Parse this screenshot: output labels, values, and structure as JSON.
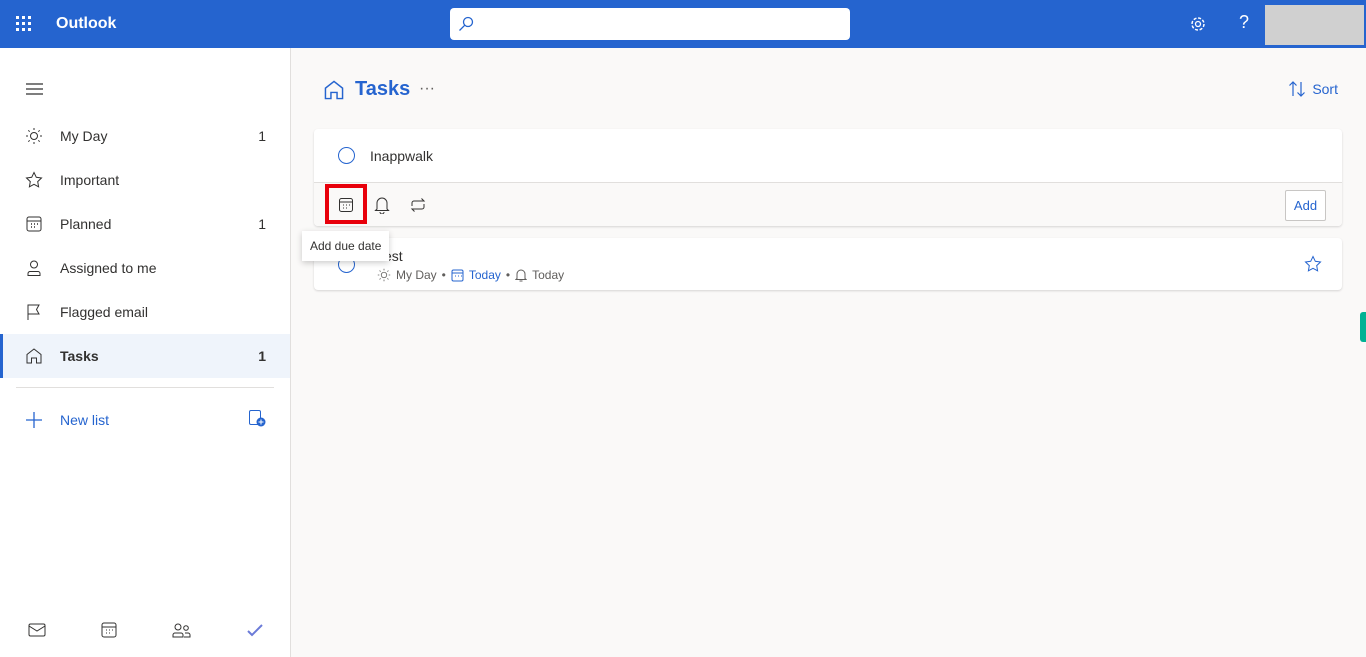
{
  "header": {
    "app_name": "Outlook",
    "search_placeholder": "",
    "help": "?"
  },
  "sidebar": {
    "items": [
      {
        "label": "My Day",
        "count": "1",
        "icon": "sun-icon"
      },
      {
        "label": "Important",
        "count": "",
        "icon": "star-icon"
      },
      {
        "label": "Planned",
        "count": "1",
        "icon": "calendar-icon"
      },
      {
        "label": "Assigned to me",
        "count": "",
        "icon": "person-icon"
      },
      {
        "label": "Flagged email",
        "count": "",
        "icon": "flag-icon"
      },
      {
        "label": "Tasks",
        "count": "1",
        "icon": "home-icon",
        "selected": true
      }
    ],
    "new_list": "New list"
  },
  "main": {
    "title": "Tasks",
    "more": "···",
    "sort": "Sort",
    "new_task": {
      "title": "Inappwalk",
      "add": "Add",
      "tooltip": "Add due date"
    },
    "tasks": [
      {
        "title": "Test",
        "my_day": "My Day",
        "due": "Today",
        "reminder": "Today"
      }
    ]
  },
  "colors": {
    "accent": "#2564cf",
    "highlight": "#e8000b"
  }
}
